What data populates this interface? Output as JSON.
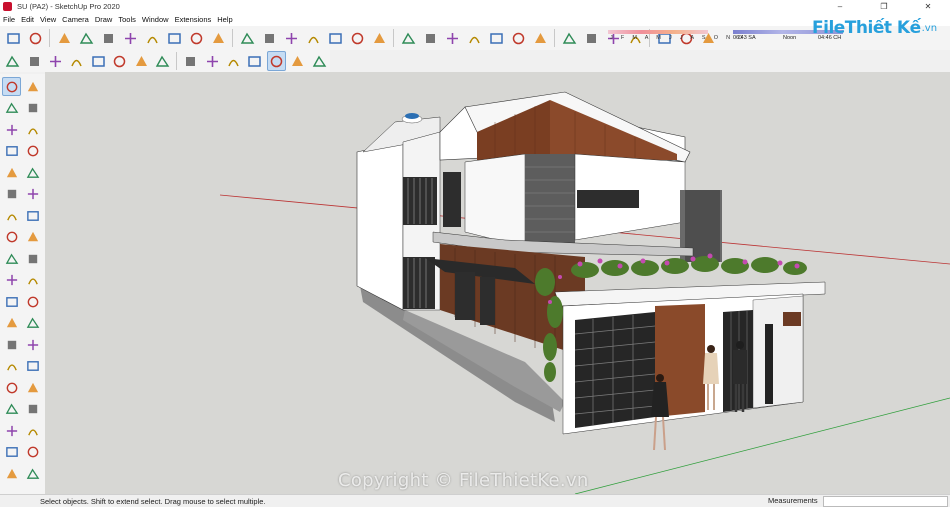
{
  "window": {
    "title": "SU (PA2) - SketchUp Pro 2020",
    "minimize": "–",
    "maximize": "❐",
    "close": "✕"
  },
  "menu": [
    "File",
    "Edit",
    "View",
    "Camera",
    "Draw",
    "Tools",
    "Window",
    "Extensions",
    "Help"
  ],
  "shadow": {
    "months": "J F M A M J J A S O N D",
    "time_start": "06:43 SA",
    "time_noon": "Noon",
    "time_end": "04:46 CH"
  },
  "brand": {
    "name": "FileThiết Kế",
    "suffix": ".vn"
  },
  "status": {
    "hint": "Select objects. Shift to extend select. Drag mouse to select multiple.",
    "measurements_label": "Measurements",
    "measurements_value": ""
  },
  "watermark": "Copyright © FileThietKe.vn",
  "toolbar1_icons": [
    "select-camera-icon",
    "component-icon",
    "section-plane-icon",
    "iso-view-icon",
    "top-view-icon",
    "front-view-icon",
    "right-view-icon",
    "back-view-icon",
    "left-view-icon",
    "bottom-view-icon",
    "zoom-extents-icon",
    "orbit-icon",
    "walk-icon",
    "warehouse-icon",
    "3d-warehouse-icon",
    "extension-warehouse-icon",
    "layout-icon",
    "styles-icon",
    "vray-icon",
    "vray-lights-icon",
    "teapot-icon",
    "render-icon",
    "interactive-render-icon",
    "refresh-icon",
    "shadow-settings-icon",
    "fog-icon",
    "scene-icon",
    "outliner-icon",
    "layers-icon",
    "lock-icon",
    "eraser-icon"
  ],
  "toolbar2_icons": [
    "model-info-icon",
    "paint-bucket-icon",
    "tape-icon",
    "protractor-icon",
    "axes-icon",
    "light-icon",
    "soften-icon",
    "section-cut-icon",
    "xray-icon",
    "back-edges-icon",
    "wireframe-icon",
    "hidden-line-icon",
    "shaded-icon",
    "shaded-textures-icon",
    "monochrome-icon"
  ],
  "left_icons": [
    "select-arrow-icon",
    "eraser-box-icon",
    "paint-icon",
    "eraser-icon",
    "line-icon",
    "freehand-icon",
    "rectangle-icon",
    "rotated-rect-icon",
    "circle-icon",
    "polygon-icon",
    "arc-icon",
    "pie-icon",
    "two-point-arc-icon",
    "three-point-arc-icon",
    "move-icon",
    "push-pull-icon",
    "rotate-icon",
    "follow-me-icon",
    "scale-icon",
    "offset-icon",
    "tape-measure-icon",
    "dimension-icon",
    "protractor-icon",
    "text-icon",
    "axes-icon",
    "3d-text-icon",
    "orbit-icon",
    "pan-icon",
    "zoom-icon",
    "zoom-window-icon",
    "zoom-extents-icon",
    "previous-view-icon",
    "position-camera-icon",
    "look-around-icon",
    "walk-icon",
    "section-icon",
    "display-section-icon",
    "fill-section-icon"
  ],
  "accent_color": "#27a0dc"
}
